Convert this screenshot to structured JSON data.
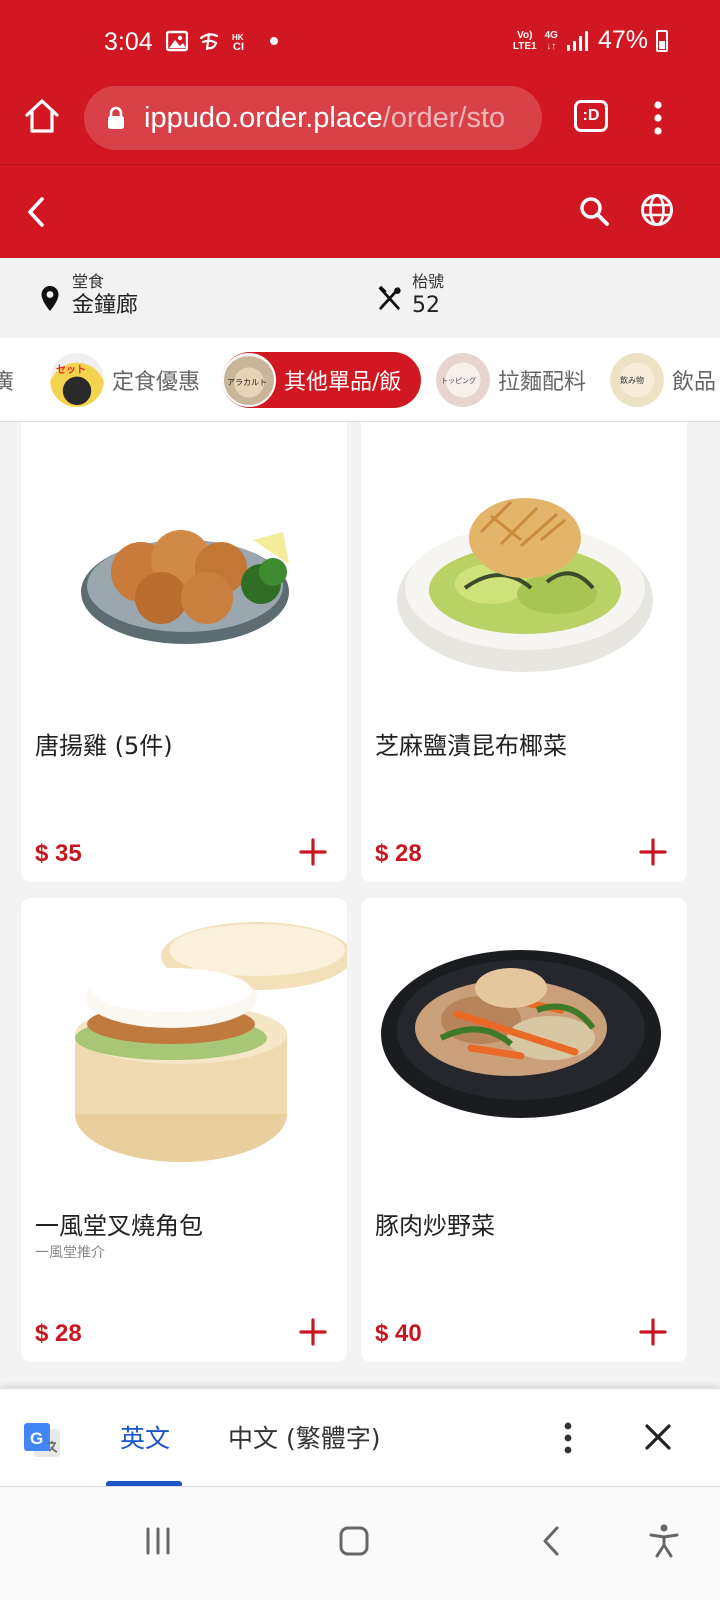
{
  "status_bar": {
    "time": "3:04",
    "network_top": "Vo)",
    "network_bottom": "LTE1",
    "data_top": "4G",
    "data_bottom": "↓↑",
    "battery": "47%"
  },
  "browser": {
    "url_host": "ippudo.order.place",
    "url_path": "/order/sto",
    "tab_label": ":D"
  },
  "info": {
    "dine_label": "堂食",
    "dine_value": "金鐘廊",
    "table_label": "枱號",
    "table_value": "52"
  },
  "categories": [
    {
      "label": "推廣",
      "active": false
    },
    {
      "label": "定食優惠",
      "active": false
    },
    {
      "label": "其他單品/飯",
      "active": true
    },
    {
      "label": "拉麵配料",
      "active": false
    },
    {
      "label": "飲品",
      "active": false
    }
  ],
  "category_thumb_texts": [
    "セット",
    "アラカルト",
    "トッピング",
    "飲み物"
  ],
  "items": [
    {
      "name": "唐揚雞 (5件)",
      "sub": "",
      "price": "$ 35"
    },
    {
      "name": "芝麻鹽漬昆布椰菜",
      "sub": "",
      "price": "$ 28"
    },
    {
      "name": "一風堂叉燒角包",
      "sub": "一風堂推介",
      "price": "$ 28"
    },
    {
      "name": "豚肉炒野菜",
      "sub": "",
      "price": "$ 40"
    }
  ],
  "translate_bar": {
    "lang_source": "英文",
    "lang_target": "中文 (繁體字)"
  },
  "colors": {
    "brand": "#d11822",
    "price": "#c8151f",
    "translate_active": "#1a57c6"
  }
}
